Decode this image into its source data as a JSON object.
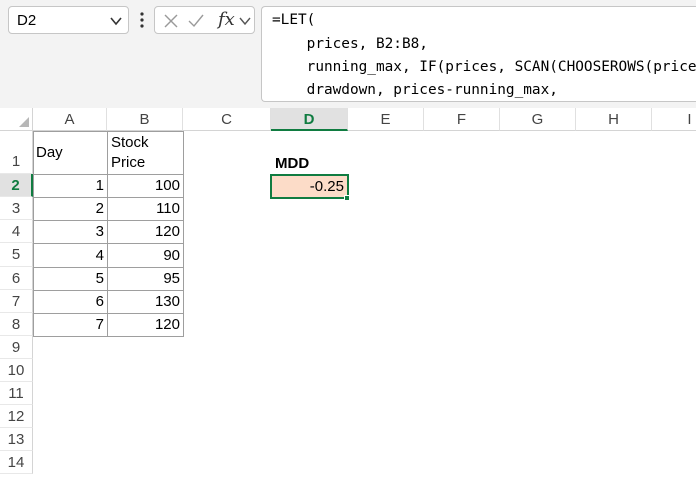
{
  "name_box": {
    "value": "D2"
  },
  "formula_bar": {
    "fx_label": "fx",
    "lines": [
      "=LET(",
      "    prices, B2:B8,",
      "    running_max, IF(prices, SCAN(CHOOSEROWS(prices",
      "    drawdown, prices-running_max,"
    ]
  },
  "columns": [
    "A",
    "B",
    "C",
    "D",
    "E",
    "F",
    "G",
    "H",
    "I"
  ],
  "selected_column": "D",
  "rows": [
    "1",
    "2",
    "3",
    "4",
    "5",
    "6",
    "7",
    "8",
    "9",
    "10",
    "11",
    "12",
    "13",
    "14"
  ],
  "selected_row": "2",
  "table": {
    "header_day": "Day",
    "header_price_line1": "Stock",
    "header_price_line2": "Price",
    "days": [
      "1",
      "2",
      "3",
      "4",
      "5",
      "6",
      "7"
    ],
    "prices": [
      "100",
      "110",
      "120",
      "90",
      "95",
      "130",
      "120"
    ]
  },
  "result": {
    "label": "MDD",
    "value": "-0.25",
    "fill_color": "#fcdcc8",
    "selection_color": "#107c41"
  }
}
